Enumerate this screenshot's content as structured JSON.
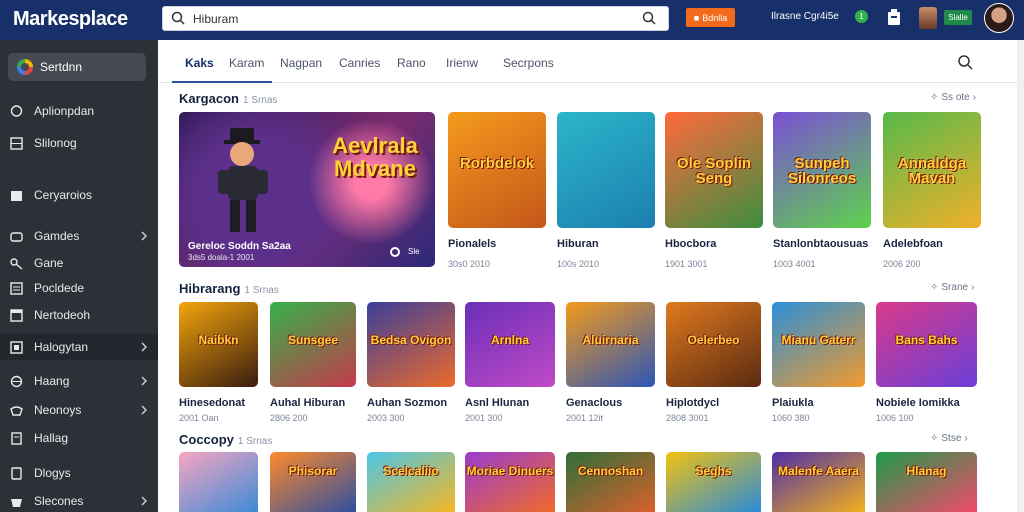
{
  "header": {
    "logo": "Markesplace",
    "search_value": "Hiburam",
    "promo_label": "Bdnlla",
    "account_label": "Ilrasne Cgr4i5e",
    "badge_label": "1",
    "pill_label": "Slalle"
  },
  "sidebar": {
    "active_item": "Sertdnn",
    "items": [
      {
        "label": "Aplionpdan",
        "icon": "chat-icon",
        "chevron": false
      },
      {
        "label": "Slilonog",
        "icon": "grid-icon",
        "chevron": false
      },
      {
        "label": "Ceryaroios",
        "icon": "library-icon",
        "chevron": false
      },
      {
        "label": "Gamdes",
        "icon": "games-icon",
        "chevron": true
      },
      {
        "label": "Gane",
        "icon": "key-icon",
        "chevron": false
      },
      {
        "label": "Pocldede",
        "icon": "list-icon",
        "chevron": false
      },
      {
        "label": "Nertodeoh",
        "icon": "window-icon",
        "chevron": false
      },
      {
        "label": "Halogytan",
        "icon": "box-icon",
        "chevron": true
      },
      {
        "label": "Haang",
        "icon": "globe-icon",
        "chevron": true
      },
      {
        "label": "Neonoys",
        "icon": "controller-icon",
        "chevron": true
      },
      {
        "label": "Hallag",
        "icon": "doc-icon",
        "chevron": false
      },
      {
        "label": "Dlogys",
        "icon": "tablet-icon",
        "chevron": false
      },
      {
        "label": "Slecones",
        "icon": "bag-icon",
        "chevron": true
      }
    ]
  },
  "tabs": [
    "Kaks",
    "Karam",
    "Nagpan",
    "Canries",
    "Rano",
    "Irienw",
    "Secrpons"
  ],
  "sections": [
    {
      "title": "Kargacon",
      "count": "1 Srnas",
      "see_all": "Ss ote",
      "featured": {
        "title_line1": "Aevlrala",
        "title_line2": "Mdvane",
        "subtitle": "Gereloc Soddn Sa2aa",
        "meta": "3ds5 doala-1 2001",
        "badge": "Sle"
      },
      "games": [
        {
          "title": "Pionalels",
          "meta": "30s0 2010",
          "art": "Rorbdelok"
        },
        {
          "title": "Hiburan",
          "meta": "100s 2010",
          "art": ""
        },
        {
          "title": "Hbocbora",
          "meta": "1901 3001",
          "art": "Ole Soplin Seng"
        },
        {
          "title": "Stanlonbtaousuas",
          "meta": "1003 4001",
          "art": "Sunpeh Silonreos"
        },
        {
          "title": "Adelebfoan",
          "meta": "2006 200",
          "art": "Annaldga Mavan"
        }
      ]
    },
    {
      "title": "Hibrarang",
      "count": "1 Srnas",
      "see_all": "Srane",
      "games": [
        {
          "title": "Hinesedonat",
          "meta": "2001 Oan",
          "art": "Naibkn"
        },
        {
          "title": "Auhal Hiburan",
          "meta": "2806 200",
          "art": "Sunsgee"
        },
        {
          "title": "Auhan Sozmon",
          "meta": "2003 300",
          "art": "Bedsa Ovigon"
        },
        {
          "title": "Asnl Hlunan",
          "meta": "2001 300",
          "art": "Arnlna"
        },
        {
          "title": "Genaclous",
          "meta": "2001 12it",
          "art": "Aluirnaria"
        },
        {
          "title": "Hiplotdycl",
          "meta": "2808 3001",
          "art": "Oelerbeo"
        },
        {
          "title": "Plaiukla",
          "meta": "1060 380",
          "art": "Mianu Gaterr"
        },
        {
          "title": "Nobiele Iomikka",
          "meta": "1006 100",
          "art": "Bans Bahs"
        }
      ]
    },
    {
      "title": "Coccopy",
      "count": "1 Srnas",
      "see_all": "Stse",
      "games": [
        {
          "art": ""
        },
        {
          "art": "Phisorar"
        },
        {
          "art": "Scelcaliio"
        },
        {
          "art": "Moriae Dinuers"
        },
        {
          "art": "Cennoshan"
        },
        {
          "art": "Seghs"
        },
        {
          "art": "Malenfe Aaera"
        },
        {
          "art": "Hlanag"
        }
      ]
    }
  ],
  "colors": {
    "topbar": "#17306a",
    "sidebar": "#2d3037",
    "accent": "#f26a1b"
  }
}
